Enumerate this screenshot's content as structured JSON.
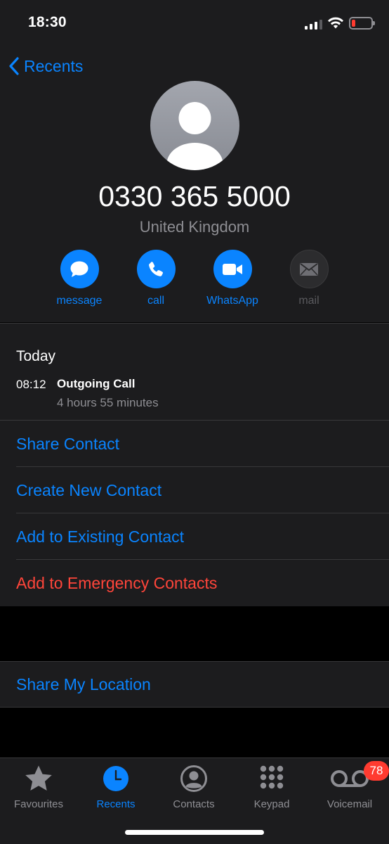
{
  "status_bar": {
    "time": "18:30"
  },
  "nav": {
    "back_label": "Recents"
  },
  "contact": {
    "number": "0330 365 5000",
    "country": "United Kingdom"
  },
  "actions": [
    {
      "label": "message",
      "icon": "message-bubble-icon",
      "enabled": true
    },
    {
      "label": "call",
      "icon": "phone-icon",
      "enabled": true
    },
    {
      "label": "WhatsApp",
      "icon": "video-camera-icon",
      "enabled": true
    },
    {
      "label": "mail",
      "icon": "envelope-icon",
      "enabled": false
    }
  ],
  "history": {
    "heading": "Today",
    "entries": [
      {
        "time": "08:12",
        "type": "Outgoing Call",
        "duration": "4 hours 55 minutes"
      }
    ]
  },
  "menu": [
    {
      "label": "Share Contact"
    },
    {
      "label": "Create New Contact"
    },
    {
      "label": "Add to Existing Contact"
    },
    {
      "label": "Add to Emergency Contacts"
    }
  ],
  "location": {
    "label": "Share My Location"
  },
  "tabs": [
    {
      "label": "Favourites",
      "icon": "star-icon"
    },
    {
      "label": "Recents",
      "icon": "clock-icon",
      "active": true
    },
    {
      "label": "Contacts",
      "icon": "person-circle-icon"
    },
    {
      "label": "Keypad",
      "icon": "keypad-icon"
    },
    {
      "label": "Voicemail",
      "icon": "voicemail-icon",
      "badge": "78"
    }
  ],
  "colors": {
    "accent": "#0a84ff",
    "danger": "#ff453a",
    "background": "#1c1c1e"
  }
}
